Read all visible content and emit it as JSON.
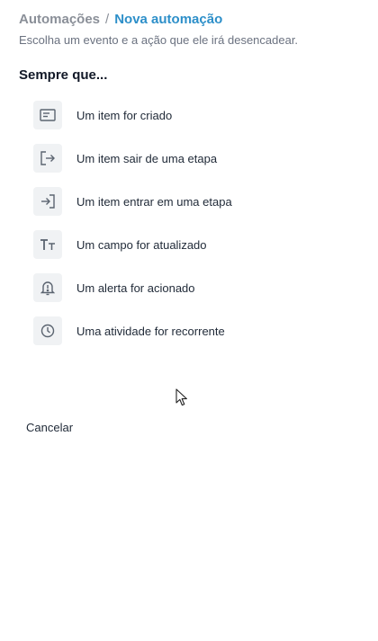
{
  "breadcrumb": {
    "root": "Automações",
    "separator": "/",
    "current": "Nova automação"
  },
  "subtitle": "Escolha um evento e a ação que ele irá desencadear.",
  "section_title": "Sempre que...",
  "events": [
    {
      "label": "Um item for criado",
      "icon": "card-icon"
    },
    {
      "label": "Um item sair de uma etapa",
      "icon": "exit-icon"
    },
    {
      "label": "Um item entrar em uma etapa",
      "icon": "enter-icon"
    },
    {
      "label": "Um campo for atualizado",
      "icon": "text-size-icon"
    },
    {
      "label": "Um alerta for acionado",
      "icon": "bell-alert-icon"
    },
    {
      "label": "Uma atividade for recorrente",
      "icon": "clock-icon"
    }
  ],
  "cancel_label": "Cancelar",
  "colors": {
    "accent": "#2d8fc9",
    "muted": "#8a8f98",
    "icon_bg": "#f0f2f4"
  }
}
